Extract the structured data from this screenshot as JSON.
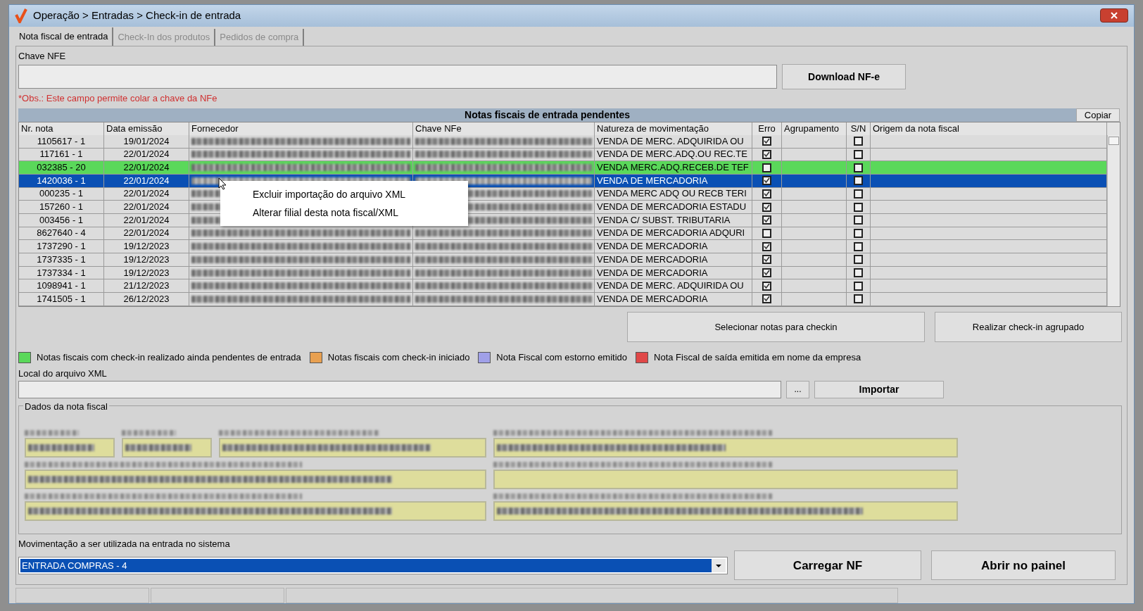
{
  "window": {
    "title": "Operação > Entradas > Check-in de entrada"
  },
  "tabs": [
    {
      "label": "Nota fiscal de entrada",
      "selected": true
    },
    {
      "label": "Check-In dos produtos",
      "selected": false
    },
    {
      "label": "Pedidos de compra",
      "selected": false
    }
  ],
  "chave_nfe": {
    "label": "Chave NFE",
    "button": "Download NF-e",
    "note": "*Obs.: Este campo permite colar a chave da NFe"
  },
  "table": {
    "title": "Notas fiscais de entrada pendentes",
    "copy_button": "Copiar",
    "columns": [
      "Nr. nota",
      "Data emissão",
      "Fornecedor",
      "Chave NFe",
      "Natureza de movimentação",
      "Erro",
      "Agrupamento",
      "S/N",
      "Origem da nota fiscal"
    ],
    "rows": [
      {
        "nr": "1105617 - 1",
        "date": "19/01/2024",
        "natureza": "VENDA DE MERC. ADQUIRIDA OU",
        "erro": true,
        "sn": false,
        "selected": false
      },
      {
        "nr": "117161 - 1",
        "date": "22/01/2024",
        "natureza": "VENDA DE MERC.ADQ.OU REC.TE",
        "erro": true,
        "sn": false,
        "selected": false
      },
      {
        "nr": "032385 - 20",
        "date": "22/01/2024",
        "natureza": "VENDA MERC.ADQ.RECEB.DE TEF",
        "erro": false,
        "sn": false,
        "selected": false,
        "color": "#5ad85a"
      },
      {
        "nr": "1420036 - 1",
        "date": "22/01/2024",
        "natureza": "VENDA DE MERCADORIA",
        "erro": true,
        "sn": false,
        "selected": true
      },
      {
        "nr": "000235 - 1",
        "date": "22/01/2024",
        "natureza": "VENDA MERC ADQ OU RECB TERI",
        "erro": true,
        "sn": false,
        "selected": false
      },
      {
        "nr": "157260 - 1",
        "date": "22/01/2024",
        "natureza": "VENDA DE MERCADORIA ESTADU",
        "erro": true,
        "sn": false,
        "selected": false
      },
      {
        "nr": "003456 - 1",
        "date": "22/01/2024",
        "natureza": "VENDA C/ SUBST. TRIBUTARIA",
        "erro": true,
        "sn": false,
        "selected": false
      },
      {
        "nr": "8627640 - 4",
        "date": "22/01/2024",
        "natureza": "VENDA DE MERCADORIA ADQURI",
        "erro": false,
        "sn": false,
        "selected": false
      },
      {
        "nr": "1737290 - 1",
        "date": "19/12/2023",
        "natureza": "VENDA DE MERCADORIA",
        "erro": true,
        "sn": false,
        "selected": false
      },
      {
        "nr": "1737335 - 1",
        "date": "19/12/2023",
        "natureza": "VENDA DE MERCADORIA",
        "erro": true,
        "sn": false,
        "selected": false
      },
      {
        "nr": "1737334 - 1",
        "date": "19/12/2023",
        "natureza": "VENDA DE MERCADORIA",
        "erro": true,
        "sn": false,
        "selected": false
      },
      {
        "nr": "1098941 - 1",
        "date": "21/12/2023",
        "natureza": "VENDA DE MERC. ADQUIRIDA OU",
        "erro": true,
        "sn": false,
        "selected": false
      },
      {
        "nr": "1741505 - 1",
        "date": "26/12/2023",
        "natureza": "VENDA DE MERCADORIA",
        "erro": true,
        "sn": false,
        "selected": false
      }
    ]
  },
  "context_menu": [
    "Excluir importação do arquivo XML",
    "Alterar filial desta nota fiscal/XML"
  ],
  "table_buttons": [
    "Selecionar notas para checkin",
    "Realizar check-in agrupado"
  ],
  "legend": [
    {
      "label": "Notas fiscais com check-in realizado ainda pendentes de entrada",
      "color": "#5ad85a"
    },
    {
      "label": "Notas fiscais com check-in iniciado",
      "color": "#e8a050"
    },
    {
      "label": "Nota Fiscal com estorno emitido",
      "color": "#a0a0e8"
    },
    {
      "label": "Nota Fiscal de saída emitida em nome da empresa",
      "color": "#e04848"
    }
  ],
  "xml": {
    "label": "Local do arquivo XML",
    "browse_button": "...",
    "import_button": "Importar"
  },
  "dados": {
    "title": "Dados da nota fiscal"
  },
  "movimentacao": {
    "label": "Movimentação a ser utilizada na entrada no sistema",
    "value": "ENTRADA COMPRAS - 4"
  },
  "bottom_buttons": [
    "Carregar NF",
    "Abrir no painel"
  ]
}
